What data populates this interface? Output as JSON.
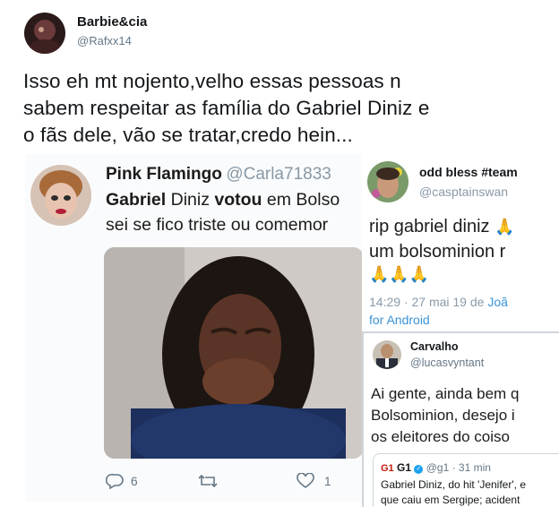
{
  "tweet": {
    "display_name": "Barbie&cia",
    "handle": "@Rafxx14",
    "text_lines": [
      "Isso eh mt nojento,velho essas pessoas n",
      "sabem respeitar as família do Gabriel Diniz e",
      "o fãs dele, vão se tratar,credo hein..."
    ]
  },
  "shot_a": {
    "name": "Pink Flamingo",
    "handle": "@Carla71833",
    "line1_a": "Gabriel",
    "line1_b": " Diniz ",
    "line1_c": "votou",
    "line1_d": " em Bolso",
    "line2": "sei se fico triste ou comemor",
    "replies": "6",
    "likes": "1"
  },
  "shot_b": {
    "name": "odd bless #team",
    "handle": "@casptainswan",
    "line1": "rip gabriel diniz",
    "line2": "um bolsominion r",
    "emoji_line": "🙏🙏🙏",
    "meta_a": "14:29 · 27 mai 19 de ",
    "meta_link_a": "Joã",
    "meta_link_b": "for Android"
  },
  "shot_c": {
    "name": "Carvalho",
    "handle": "@lucasvyntant",
    "line1": "Ai gente, ainda bem q",
    "line2": "Bolsominion, desejo i",
    "line3": "os eleitores do coiso",
    "quote_logo": "G1",
    "quote_name": "G1",
    "quote_meta": "@g1 · 31 min",
    "quote_line1": "Gabriel Diniz, do hit 'Jenifer', e",
    "quote_line2": "que caiu em Sergipe; acident"
  },
  "colors": {
    "link": "#3b94d9",
    "muted": "#657786",
    "verified": "#1da1f2"
  }
}
